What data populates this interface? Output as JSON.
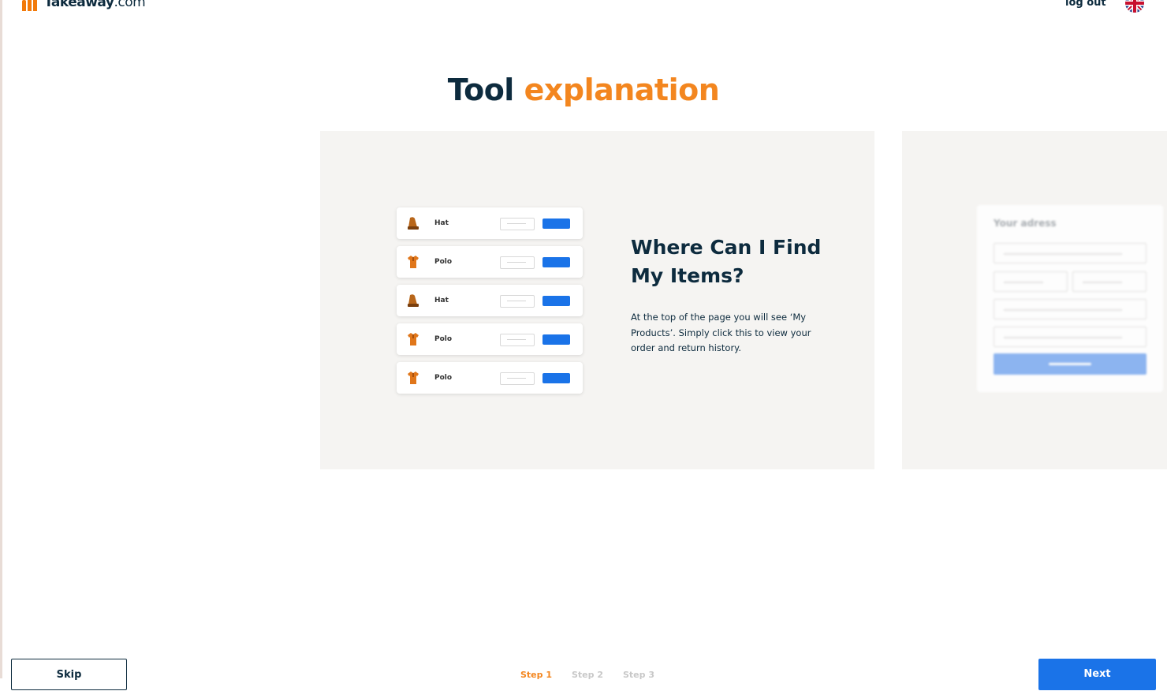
{
  "header": {
    "logo_text": "Takeaway",
    "logo_suffix": ".com",
    "logout_label": "log out",
    "language_flag": "uk-flag-icon"
  },
  "title": {
    "part1": "Tool",
    "part2": "explanation"
  },
  "colors": {
    "brand_orange": "#f3861f",
    "primary_blue": "#1a73e8",
    "navy": "#0d2b3e",
    "slide_bg": "#f5f4f2"
  },
  "slide": {
    "items": [
      {
        "label": "Hat",
        "icon": "hat-icon"
      },
      {
        "label": "Polo",
        "icon": "polo-shirt-icon"
      },
      {
        "label": "Hat",
        "icon": "hat-icon"
      },
      {
        "label": "Polo",
        "icon": "polo-shirt-icon"
      },
      {
        "label": "Polo",
        "icon": "polo-shirt-icon"
      }
    ],
    "heading": "Where Can I Find My Items?",
    "text": "At the top of the page you will see ‘My Products’. Simply click this to view your order and return history."
  },
  "next_slide": {
    "card_title": "Your adress"
  },
  "footer": {
    "skip_label": "Skip",
    "steps": [
      "Step 1",
      "Step 2",
      "Step 3"
    ],
    "active_step": 1,
    "next_label": "Next"
  }
}
